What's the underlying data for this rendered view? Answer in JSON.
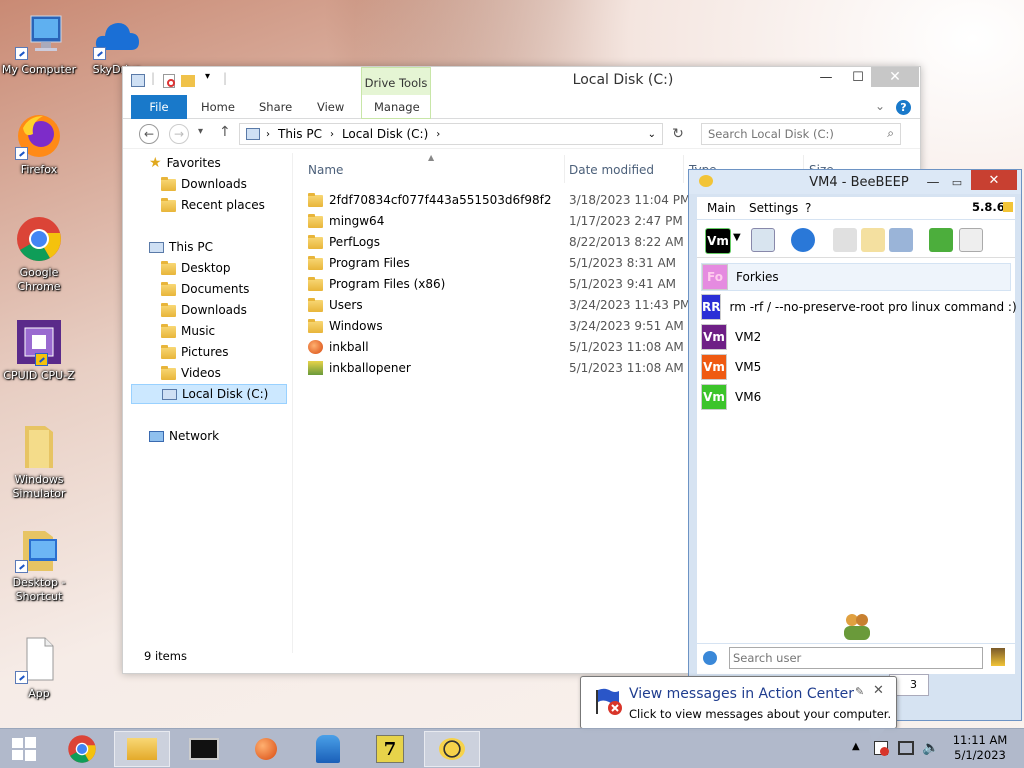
{
  "desktop": {
    "icons": [
      {
        "id": "my-computer",
        "label": "My Computer"
      },
      {
        "id": "skydrive",
        "label": "SkyDrive"
      },
      {
        "id": "firefox",
        "label": "Firefox"
      },
      {
        "id": "chrome",
        "label": "Google\nChrome"
      },
      {
        "id": "cpuz",
        "label": "CPUID CPU-Z"
      },
      {
        "id": "winsim",
        "label": "Windows\nSimulator"
      },
      {
        "id": "desktop-shortcut",
        "label": "Desktop -\nShortcut"
      },
      {
        "id": "app",
        "label": "App"
      }
    ]
  },
  "explorer": {
    "title": "Local Disk (C:)",
    "contextual_tab": "Drive Tools",
    "tabs": [
      "File",
      "Home",
      "Share",
      "View",
      "Manage"
    ],
    "breadcrumb": [
      "This PC",
      "Local Disk (C:)"
    ],
    "search_placeholder": "Search Local Disk (C:)",
    "columns": {
      "name": "Name",
      "date": "Date modified",
      "type": "Type",
      "size": "Size"
    },
    "nav": {
      "favorites": "Favorites",
      "fav_items": [
        "Downloads",
        "Recent places"
      ],
      "thispc": "This PC",
      "pc_items": [
        "Desktop",
        "Documents",
        "Downloads",
        "Music",
        "Pictures",
        "Videos",
        "Local Disk (C:)"
      ],
      "network": "Network"
    },
    "files": [
      {
        "name": "2fdf70834cf077f443a551503d6f98f2",
        "date": "3/18/2023 11:04 PM",
        "kind": "folder"
      },
      {
        "name": "mingw64",
        "date": "1/17/2023 2:47 PM",
        "kind": "folder"
      },
      {
        "name": "PerfLogs",
        "date": "8/22/2013 8:22 AM",
        "kind": "folder"
      },
      {
        "name": "Program Files",
        "date": "5/1/2023 8:31 AM",
        "kind": "folder"
      },
      {
        "name": "Program Files (x86)",
        "date": "5/1/2023 9:41 AM",
        "kind": "folder"
      },
      {
        "name": "Users",
        "date": "3/24/2023 11:43 PM",
        "kind": "folder"
      },
      {
        "name": "Windows",
        "date": "3/24/2023 9:51 AM",
        "kind": "folder"
      },
      {
        "name": "inkball",
        "date": "5/1/2023 11:08 AM",
        "kind": "app"
      },
      {
        "name": "inkballopener",
        "date": "5/1/2023 11:08 AM",
        "kind": "app2"
      }
    ],
    "status": "9 items"
  },
  "beebeep": {
    "title": "VM4 - BeeBEEP",
    "menu": [
      "Main",
      "Settings",
      "?"
    ],
    "version": "5.8.6",
    "status_avatar": "Vm",
    "users": [
      {
        "initials": "Fo",
        "name": "Forkies",
        "color": "#e58be0"
      },
      {
        "initials": "RR",
        "name": "rm -rf / --no-preserve-root pro linux command :)",
        "color": "#2b2fd6"
      },
      {
        "initials": "Vm",
        "name": "VM2",
        "color": "#6e1f86"
      },
      {
        "initials": "Vm",
        "name": "VM5",
        "color": "#ef5a12"
      },
      {
        "initials": "Vm",
        "name": "VM6",
        "color": "#3cc42a"
      }
    ],
    "search_placeholder": "Search user",
    "tab_count": "3"
  },
  "balloon": {
    "title": "View messages in Action Center",
    "text": "Click to view messages about your computer."
  },
  "taskbar": {
    "time": "11:11 AM",
    "date": "5/1/2023"
  }
}
